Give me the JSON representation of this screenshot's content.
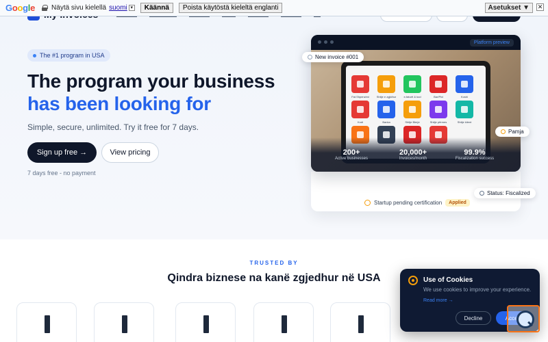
{
  "translate_bar": {
    "logo": "Google",
    "prompt": "Näytä sivu kielellä",
    "language": "suomi",
    "translate_button": "Käännä",
    "disable_button": "Poista käytöstä kieleltä englanti",
    "settings_button": "Asetukset ▼",
    "close": "✕"
  },
  "nav": {
    "brand": "My Invoices"
  },
  "hero": {
    "badge": "The #1 program in USA",
    "headline_line1": "The program your business",
    "headline_line2": "has been looking for",
    "subtitle": "Simple, secure, unlimited. Try it free for 7 days.",
    "primary_cta": "Sign up free →",
    "secondary_cta": "View pricing",
    "note": "7 days free - no payment"
  },
  "device": {
    "top_tag": "New invoice #001",
    "preview_label": "Platform preview",
    "tiles": [
      {
        "label": "Fat.Shpenzimi",
        "color": "#e53935"
      },
      {
        "label": "Shitje e zgjidhur",
        "color": "#f59e0b"
      },
      {
        "label": "e-faturë & kod",
        "color": "#22c55e"
      },
      {
        "label": "Bar/Pixi",
        "color": "#dc2626"
      },
      {
        "label": "Koshi",
        "color": "#2563eb"
      },
      {
        "label": "Kodi",
        "color": "#e53935"
      },
      {
        "label": "Banka",
        "color": "#2563eb"
      },
      {
        "label": "Shitje Blerje",
        "color": "#f59e0b"
      },
      {
        "label": "Shitje përmes",
        "color": "#7c3aed"
      },
      {
        "label": "Shitje klient",
        "color": "#14b8a6"
      },
      {
        "label": "",
        "color": "#f97316"
      },
      {
        "label": "",
        "color": "#334155"
      },
      {
        "label": "",
        "color": "#dc2626"
      },
      {
        "label": "",
        "color": "#e53935"
      }
    ],
    "stats": [
      {
        "value": "200+",
        "label": "Active businesses"
      },
      {
        "value": "20,000+",
        "label": "Invoices/month"
      },
      {
        "value": "99.9%",
        "label": "Fiscalization success"
      }
    ],
    "cert_text": "Startup pending certification",
    "cert_badge": "Applied",
    "float_right": "Pamja",
    "float_status": "Status: Fiscalized"
  },
  "trusted": {
    "label": "TRUSTED BY",
    "tagline": "Qindra biznese na kanë zgjedhur në USA"
  },
  "cookie": {
    "title": "Use of Cookies",
    "text": "We use cookies to improve your experience.",
    "read_more": "Read more →",
    "decline": "Decline",
    "accept": "Accept"
  },
  "colors": {
    "primary": "#2563eb",
    "dark": "#0f172a",
    "amber": "#f59e0b"
  }
}
